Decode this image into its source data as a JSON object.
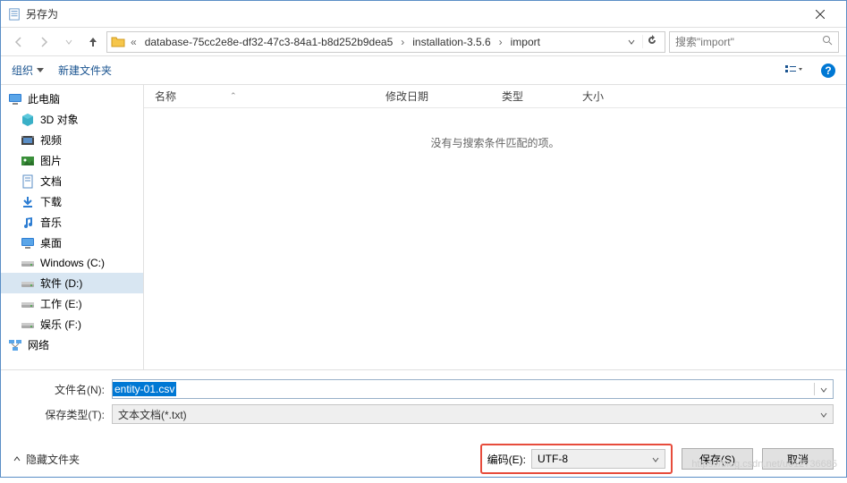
{
  "window": {
    "title": "另存为"
  },
  "breadcrumb": {
    "prefix": "«",
    "crumbs": [
      "database-75cc2e8e-df32-47c3-84a1-b8d252b9dea5",
      "installation-3.5.6",
      "import"
    ]
  },
  "search": {
    "placeholder": "搜索\"import\""
  },
  "toolbar": {
    "organize": "组织",
    "newfolder": "新建文件夹"
  },
  "sidebar": {
    "pc": "此电脑",
    "items": [
      {
        "label": "3D 对象",
        "icon": "cube"
      },
      {
        "label": "视频",
        "icon": "film"
      },
      {
        "label": "图片",
        "icon": "image"
      },
      {
        "label": "文档",
        "icon": "doc"
      },
      {
        "label": "下载",
        "icon": "download"
      },
      {
        "label": "音乐",
        "icon": "music"
      },
      {
        "label": "桌面",
        "icon": "desktop"
      },
      {
        "label": "Windows (C:)",
        "icon": "drive"
      },
      {
        "label": "软件 (D:)",
        "icon": "drive",
        "selected": true
      },
      {
        "label": "工作 (E:)",
        "icon": "drive"
      },
      {
        "label": "娱乐 (F:)",
        "icon": "drive"
      }
    ],
    "network": "网络"
  },
  "columns": {
    "name": "名称",
    "date": "修改日期",
    "type": "类型",
    "size": "大小"
  },
  "empty": "没有与搜索条件匹配的项。",
  "footer": {
    "filename_label": "文件名(N):",
    "filename_value": "entity-01.csv",
    "filetype_label": "保存类型(T):",
    "filetype_value": "文本文档(*.txt)",
    "hide": "隐藏文件夹",
    "encoding_label": "编码(E):",
    "encoding_value": "UTF-8",
    "save": "保存(S)",
    "cancel": "取消"
  },
  "watermark": "https://blog.csdn.net/u012736685"
}
